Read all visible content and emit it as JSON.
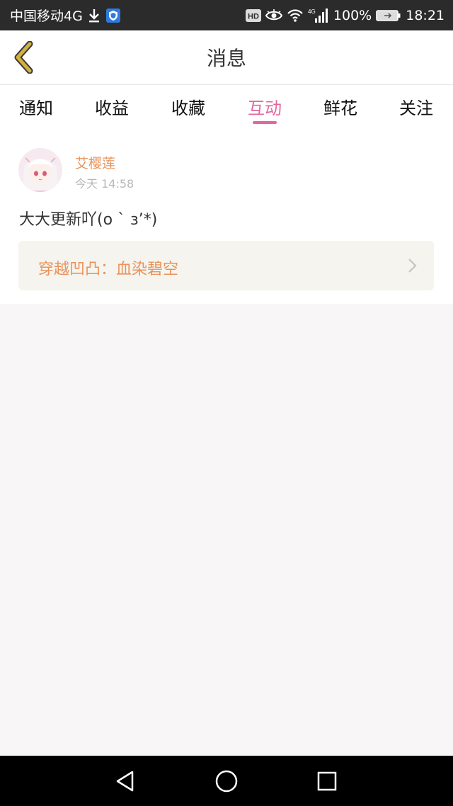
{
  "status_bar": {
    "carrier": "中国移动4G",
    "battery": "100%",
    "time": "18:21",
    "hd_label": "HD",
    "network_label": "4G",
    "icons": [
      "download-icon",
      "shield-app-icon",
      "hd-icon",
      "eye-icon",
      "wifi-icon",
      "signal-icon",
      "battery-icon"
    ]
  },
  "header": {
    "title": "消息",
    "back_icon": "chevron-left-icon",
    "back_color": "#d3b13c"
  },
  "tabs": {
    "items": [
      {
        "label": "通知"
      },
      {
        "label": "收益"
      },
      {
        "label": "收藏"
      },
      {
        "label": "互动"
      },
      {
        "label": "鲜花"
      },
      {
        "label": "关注"
      }
    ],
    "active": "互动",
    "active_color": "#e2679d"
  },
  "messages": [
    {
      "username": "艾樱莲",
      "time": "今天 14:58",
      "text": "大大更新吖(o ` з’*)",
      "reference": "穿越凹凸：血染碧空",
      "accent_color": "#e9935a"
    }
  ],
  "nav_bar": {
    "icons": [
      "back-triangle-icon",
      "home-circle-icon",
      "recents-square-icon"
    ]
  }
}
